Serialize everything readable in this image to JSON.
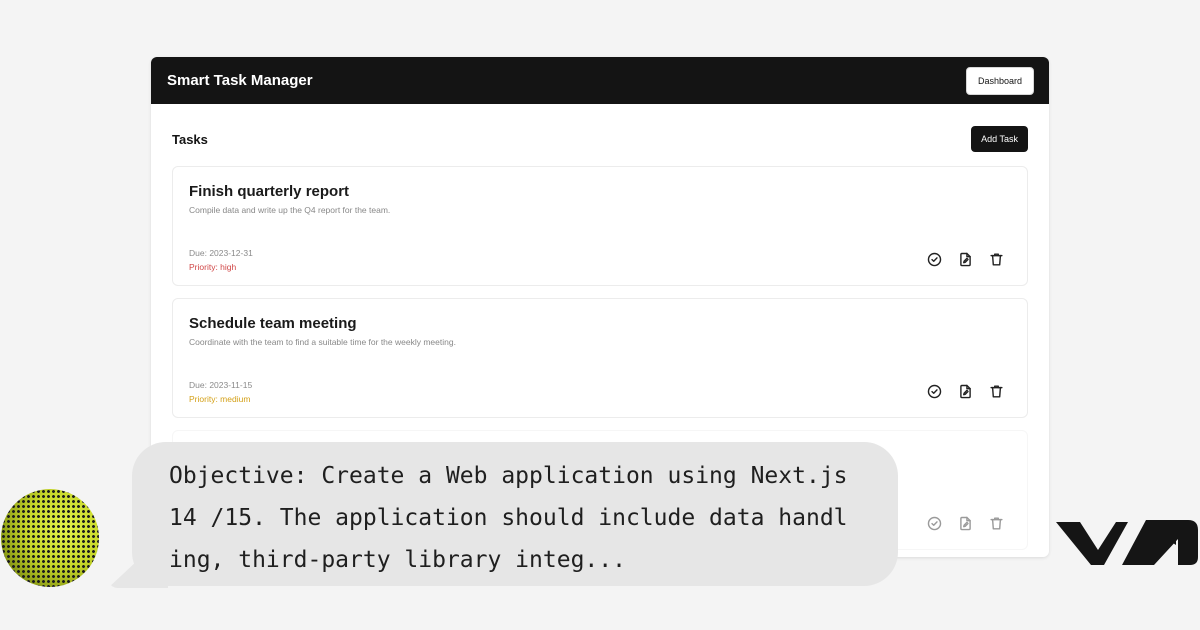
{
  "app": {
    "title": "Smart Task Manager",
    "dashboard_label": "Dashboard"
  },
  "tasks": {
    "heading": "Tasks",
    "add_label": "Add Task",
    "items": [
      {
        "title": "Finish quarterly report",
        "description": "Compile data and write up the Q4 report for the team.",
        "due": "Due: 2023-12-31",
        "priority": "Priority: high",
        "priority_color": "#d04646"
      },
      {
        "title": "Schedule team meeting",
        "description": "Coordinate with the team to find a suitable time for the weekly meeting.",
        "due": "Due: 2023-11-15",
        "priority": "Priority: medium",
        "priority_color": "#d4a017"
      }
    ]
  },
  "icons": {
    "complete": "check-circle-icon",
    "edit": "edit-document-icon",
    "delete": "trash-icon"
  },
  "chat": {
    "message": "Objective: Create a Web application using Next.js 14 /15. The application should include data handling, third-party library integ..."
  },
  "colors": {
    "topbar": "#141414",
    "avatar_accent": "#c7d72a",
    "bubble": "#e6e6e6"
  }
}
